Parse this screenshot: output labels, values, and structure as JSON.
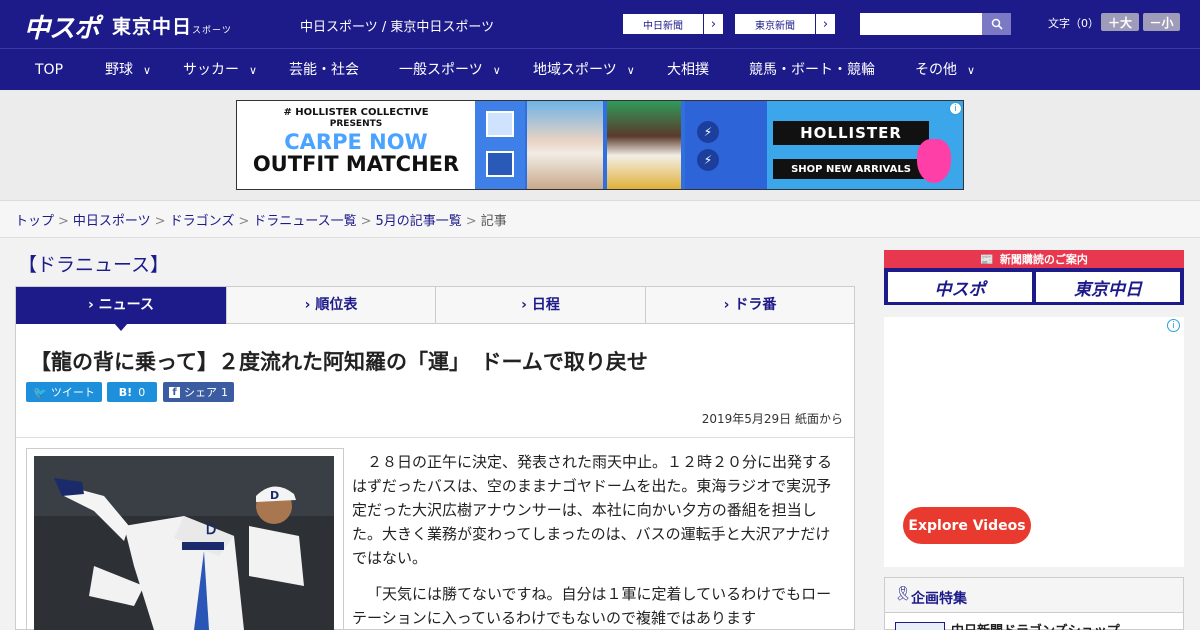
{
  "header": {
    "logo_main": "中スポ",
    "logo_sub": "東京中日",
    "logo_sub_small": "スポーツ",
    "site_title": "中日スポーツ / 東京中日スポーツ",
    "paper_links": [
      "中日新聞",
      "東京新聞"
    ],
    "search_placeholder": "",
    "font_size_label": "文字（0）",
    "font_bigger": "＋大",
    "font_smaller": "－小"
  },
  "nav": {
    "items": [
      {
        "label": "TOP",
        "dropdown": false
      },
      {
        "label": "野球",
        "dropdown": true
      },
      {
        "label": "サッカー",
        "dropdown": true
      },
      {
        "label": "芸能・社会",
        "dropdown": false
      },
      {
        "label": "一般スポーツ",
        "dropdown": true
      },
      {
        "label": "地域スポーツ",
        "dropdown": true
      },
      {
        "label": "大相撲",
        "dropdown": false
      },
      {
        "label": "競馬・ボート・競輪",
        "dropdown": false
      },
      {
        "label": "その他",
        "dropdown": true
      }
    ]
  },
  "ad_banner": {
    "brand": "# HOLLISTER COLLECTIVE",
    "presents": "PRESENTS",
    "headline1": "CARPE NOW",
    "headline2": "OUTFIT MATCHER",
    "logo": "HOLLISTER",
    "cta": "SHOP NEW ARRIVALS"
  },
  "breadcrumb": {
    "items": [
      "トップ",
      "中日スポーツ",
      "ドラゴンズ",
      "ドラニュース一覧",
      "5月の記事一覧"
    ],
    "current": "記事",
    "separator": ">"
  },
  "section_title": "【ドラニュース】",
  "tabs": [
    {
      "label": "ニュース",
      "active": true
    },
    {
      "label": "順位表",
      "active": false
    },
    {
      "label": "日程",
      "active": false
    },
    {
      "label": "ドラ番",
      "active": false
    }
  ],
  "article": {
    "headline": "【龍の背に乗って】２度流れた阿知羅の「運」　ドームで取り戻せ",
    "share": {
      "tweet": "ツイート",
      "hatena": "B!",
      "hatena_count": "0",
      "facebook": "シェア",
      "facebook_count": "1"
    },
    "date": "2019年5月29日 紙面から",
    "paragraphs": [
      "２８日の正午に決定、発表された雨天中止。１２時２０分に出発するはずだったバスは、空のままナゴヤドームを出た。東海ラジオで実況予定だった大沢広樹アナウンサーは、本社に向かい夕方の番組を担当した。大きく業務が変わってしまったのは、バスの運転手と大沢アナだけではない。",
      "「天気には勝てないですね。自分は１軍に定着しているわけでもローテーションに入っているわけでもないので複雑ではあります"
    ]
  },
  "sidebar": {
    "subscription": {
      "header": "新聞購読のご案内",
      "logos": [
        "中スポ",
        "東京中日"
      ]
    },
    "video_ad": {
      "button": "Explore Videos"
    },
    "feature": {
      "title": "企画特集",
      "first_item": "中日新聞ドラゴンズショップ"
    }
  },
  "colors": {
    "brand_navy": "#1d1a8a",
    "subscription_red": "#e8384f",
    "video_button_red": "#e83a2e",
    "tweet_blue": "#1d8fdb",
    "facebook_blue": "#3b5ca0"
  }
}
